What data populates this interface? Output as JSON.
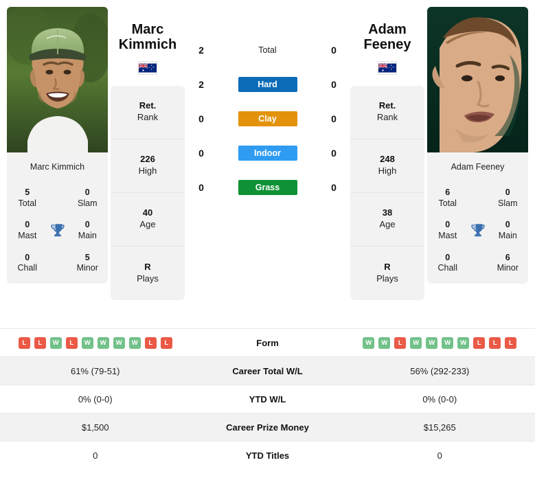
{
  "players": {
    "left": {
      "first_name": "Marc",
      "last_name": "Kimmich",
      "full_name": "Marc Kimmich",
      "photo_caption": "Marc Kimmich",
      "flag": "australia-flag",
      "rank": {
        "value": "Ret.",
        "label": "Rank"
      },
      "high": {
        "value": "226",
        "label": "High"
      },
      "age": {
        "value": "40",
        "label": "Age"
      },
      "plays": {
        "value": "R",
        "label": "Plays"
      },
      "titles": {
        "total": {
          "value": "5",
          "label": "Total"
        },
        "slam": {
          "value": "0",
          "label": "Slam"
        },
        "mast": {
          "value": "0",
          "label": "Mast"
        },
        "main": {
          "value": "0",
          "label": "Main"
        },
        "chall": {
          "value": "0",
          "label": "Chall"
        },
        "minor": {
          "value": "5",
          "label": "Minor"
        }
      },
      "form": [
        "L",
        "L",
        "W",
        "L",
        "W",
        "W",
        "W",
        "W",
        "L",
        "L"
      ],
      "career_total_wl": "61% (79-51)",
      "ytd_wl": "0% (0-0)",
      "career_prize_money": "$1,500",
      "ytd_titles": "0"
    },
    "right": {
      "first_name": "Adam",
      "last_name": "Feeney",
      "full_name": "Adam Feeney",
      "photo_caption": "Adam Feeney",
      "flag": "australia-flag",
      "rank": {
        "value": "Ret.",
        "label": "Rank"
      },
      "high": {
        "value": "248",
        "label": "High"
      },
      "age": {
        "value": "38",
        "label": "Age"
      },
      "plays": {
        "value": "R",
        "label": "Plays"
      },
      "titles": {
        "total": {
          "value": "6",
          "label": "Total"
        },
        "slam": {
          "value": "0",
          "label": "Slam"
        },
        "mast": {
          "value": "0",
          "label": "Mast"
        },
        "main": {
          "value": "0",
          "label": "Main"
        },
        "chall": {
          "value": "0",
          "label": "Chall"
        },
        "minor": {
          "value": "6",
          "label": "Minor"
        }
      },
      "form": [
        "W",
        "W",
        "L",
        "W",
        "W",
        "W",
        "W",
        "L",
        "L",
        "L"
      ],
      "career_total_wl": "56% (292-233)",
      "ytd_wl": "0% (0-0)",
      "career_prize_money": "$15,265",
      "ytd_titles": "0"
    }
  },
  "head_to_head": {
    "rows": [
      {
        "label": "Total",
        "left": "2",
        "right": "0",
        "style": "plain",
        "color": ""
      },
      {
        "label": "Hard",
        "left": "2",
        "right": "0",
        "style": "badge",
        "color": "#0c6cb8"
      },
      {
        "label": "Clay",
        "left": "0",
        "right": "0",
        "style": "badge",
        "color": "#e2930b"
      },
      {
        "label": "Indoor",
        "left": "0",
        "right": "0",
        "style": "badge",
        "color": "#2f9cf2"
      },
      {
        "label": "Grass",
        "left": "0",
        "right": "0",
        "style": "badge",
        "color": "#0e9235"
      }
    ]
  },
  "stats_table": {
    "rows": [
      {
        "label": "Form",
        "kind": "form",
        "alt": false
      },
      {
        "label": "Career Total W/L",
        "kind": "text",
        "alt": true,
        "left": "61% (79-51)",
        "right": "56% (292-233)"
      },
      {
        "label": "YTD W/L",
        "kind": "text",
        "alt": false,
        "left": "0% (0-0)",
        "right": "0% (0-0)"
      },
      {
        "label": "Career Prize Money",
        "kind": "text",
        "alt": true,
        "left": "$1,500",
        "right": "$15,265"
      },
      {
        "label": "YTD Titles",
        "kind": "text",
        "alt": false,
        "left": "0",
        "right": "0"
      }
    ]
  },
  "colors": {
    "win_badge": "#72c18a",
    "loss_badge": "#ea5a47",
    "trophy": "#3a6fb0",
    "card_bg": "#f2f2f2",
    "row_alt_bg": "#f2f2f2"
  }
}
